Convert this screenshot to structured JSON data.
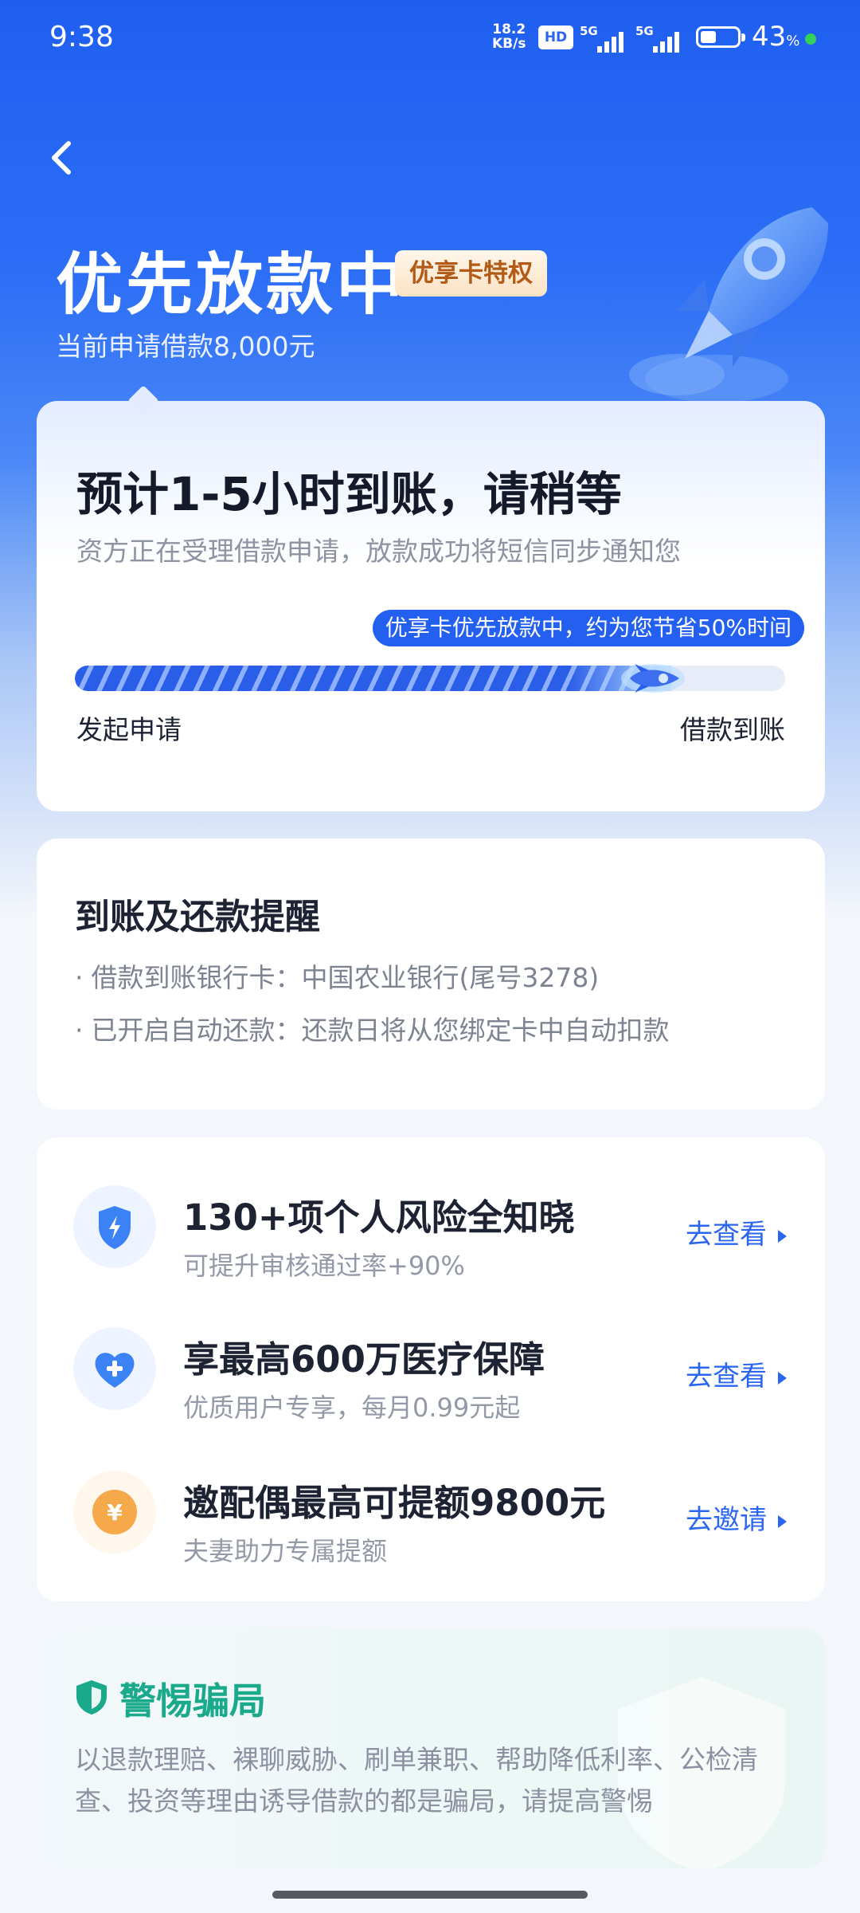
{
  "status_bar": {
    "time": "9:38",
    "net_speed_value": "18.2",
    "net_speed_unit": "KB/s",
    "hd_label": "HD",
    "signal1_label": "5G",
    "signal2_label": "5G",
    "battery_level": 0.43,
    "battery_text": "43",
    "battery_unit": "%"
  },
  "header": {
    "title": "优先放款中",
    "badge": "优享卡特权",
    "subtitle": "当前申请借款8,000元"
  },
  "progress_card": {
    "heading": "预计1-5小时到账，请稍等",
    "description": "资方正在受理借款申请，放款成功将短信同步通知您",
    "bubble_text": "优享卡优先放款中，约为您节省50%时间",
    "progress": 0.84,
    "start_label": "发起申请",
    "end_label": "借款到账"
  },
  "reminder_card": {
    "heading": "到账及还款提醒",
    "notes": [
      "借款到账银行卡：中国农业银行(尾号3278)",
      "已开启自动还款：还款日将从您绑定卡中自动扣款"
    ]
  },
  "features": [
    {
      "icon": "shield-lightning-icon",
      "title": "130+项个人风险全知晓",
      "subtitle": "可提升审核通过率+90%",
      "action": "去查看"
    },
    {
      "icon": "heart-plus-icon",
      "title": "享最高600万医疗保障",
      "subtitle": "优质用户专享，每月0.99元起",
      "action": "去查看"
    },
    {
      "icon": "yuan-coin-icon",
      "title": "邀配偶最高可提额9800元",
      "subtitle": "夫妻助力专属提额",
      "action": "去邀请"
    }
  ],
  "warning_card": {
    "heading": "警惕骗局",
    "body": "以退款理赔、裸聊威胁、刷单兼职、帮助降低利率、公检清查、投资等理由诱导借款的都是骗局，请提高警惕"
  },
  "colors": {
    "brand_blue": "#2a66f2",
    "warning_green": "#1aa98a",
    "badge_text": "#b25a16"
  }
}
